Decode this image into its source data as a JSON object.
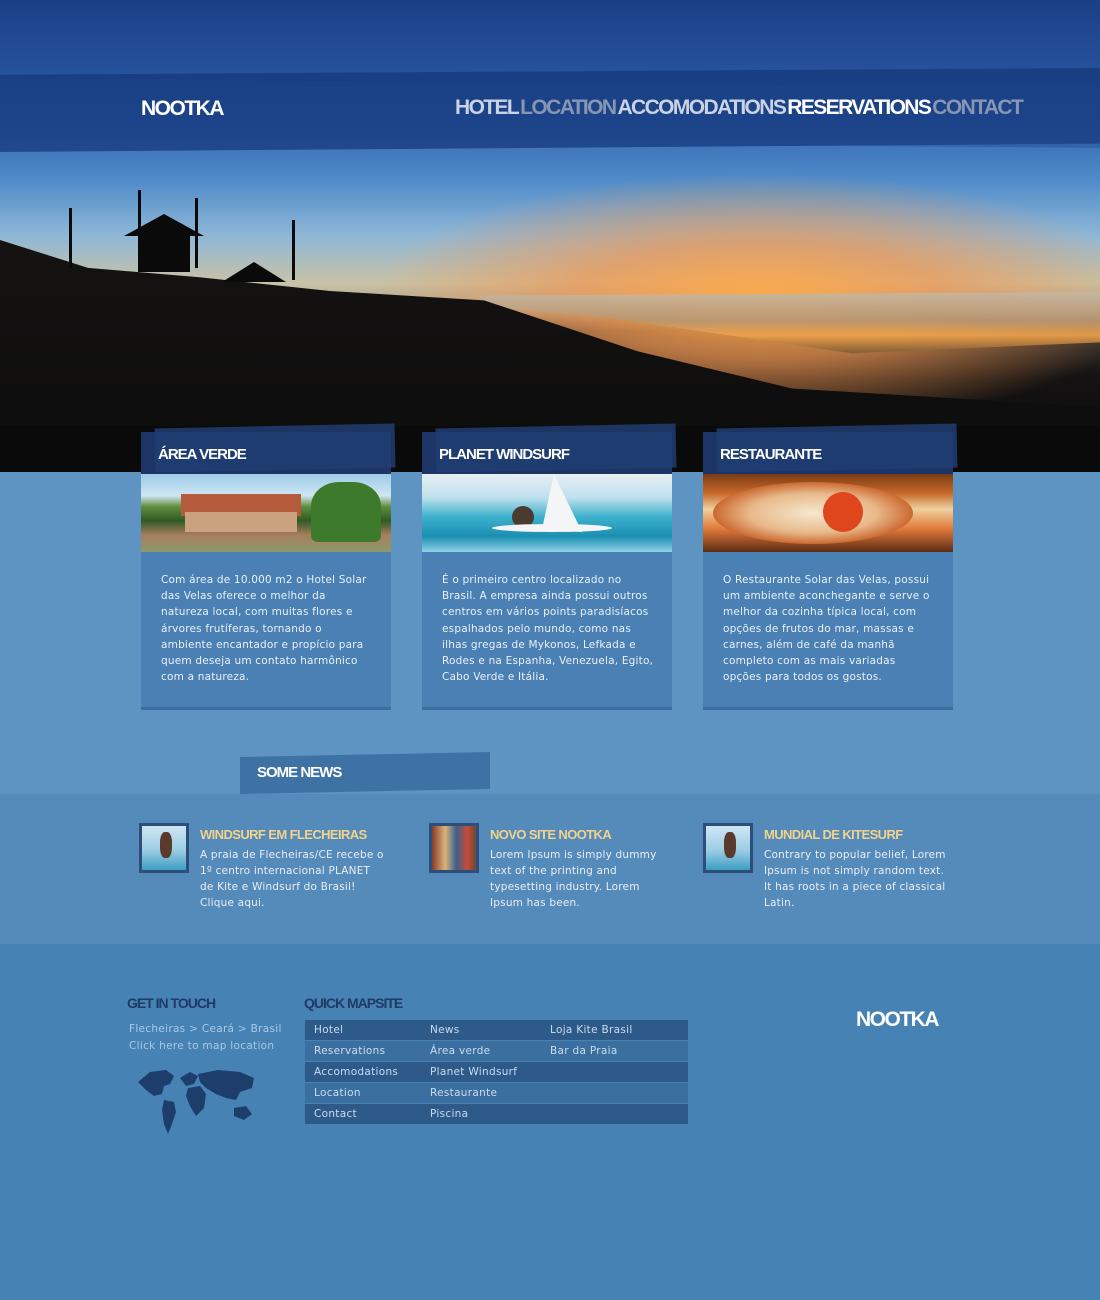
{
  "header": {
    "logo": "NOOTKA",
    "nav": [
      {
        "label": "HOTEL",
        "color": "#c9d3e3"
      },
      {
        "label": "LOCATION",
        "color": "#8797b3"
      },
      {
        "label": "ACCOMODATIONS",
        "color": "#c9d3e3"
      },
      {
        "label": "RESERVATIONS",
        "color": "#ffffff"
      },
      {
        "label": "CONTACT",
        "color": "#8797b3"
      }
    ]
  },
  "cards": [
    {
      "title": "ÁREA VERDE",
      "image": "garden-bungalows-image",
      "text": "Com área de 10.000 m2 o Hotel Solar das Velas oferece o melhor da natureza local, com muitas flores e árvores frutíferas, tornando o ambiente encantador e propício para quem deseja um contato harmônico com a natureza."
    },
    {
      "title": "PLANET WINDSURF",
      "image": "windsurfer-image",
      "text": "É o primeiro centro localizado no Brasil. A empresa ainda possui outros centros em vários points paradisíacos espalhados pelo mundo, como nas ilhas gregas de Mykonos, Lefkada e Rodes e na Espanha, Venezuela, Egito, Cabo Verde e Itália."
    },
    {
      "title": "RESTAURANTE",
      "image": "seafood-dish-image",
      "text": "O Restaurante Solar das Velas, possui um ambiente aconchegante e serve o melhor da cozinha típica local, com opções de frutos do mar, massas e carnes, além de café da manhã completo com as mais variadas opções para todos os gostos."
    }
  ],
  "news": {
    "heading": "SOME NEWS",
    "items": [
      {
        "title": "WINDSURF EM FLECHEIRAS",
        "text": "A praia de Flecheiras/CE recebe o 1º centro internacional PLANET de Kite e Windsurf do Brasil! Clique aqui."
      },
      {
        "title": "NOVO SITE NOOTKA",
        "text": "Lorem Ipsum is simply dummy text of the printing and typesetting industry. Lorem Ipsum has been."
      },
      {
        "title": "MUNDIAL DE KITESURF",
        "text": "Contrary to popular belief, Lorem Ipsum is not simply random text. It has roots in a piece of classical Latin."
      }
    ]
  },
  "footer": {
    "get_in_touch": {
      "heading": "GET IN TOUCH",
      "address": "Flecheiras > Ceará > Brasil",
      "map_link": "Click here to map location"
    },
    "quick_mapsite": {
      "heading": "QUICK MAPSITE",
      "rows": [
        [
          "Hotel",
          "News",
          "Loja Kite Brasil"
        ],
        [
          "Reservations",
          "Área verde",
          "Bar da Praia"
        ],
        [
          "Accomodations",
          "Planet Windsurf",
          ""
        ],
        [
          "Location",
          "Restaurante",
          ""
        ],
        [
          "Contact",
          "Piscina",
          ""
        ]
      ]
    },
    "logo": "NOOTKA"
  },
  "colors": {
    "accent_title": "#f3d28b",
    "dark_blue": "#1c3566",
    "page_blue": "#4682b4"
  }
}
